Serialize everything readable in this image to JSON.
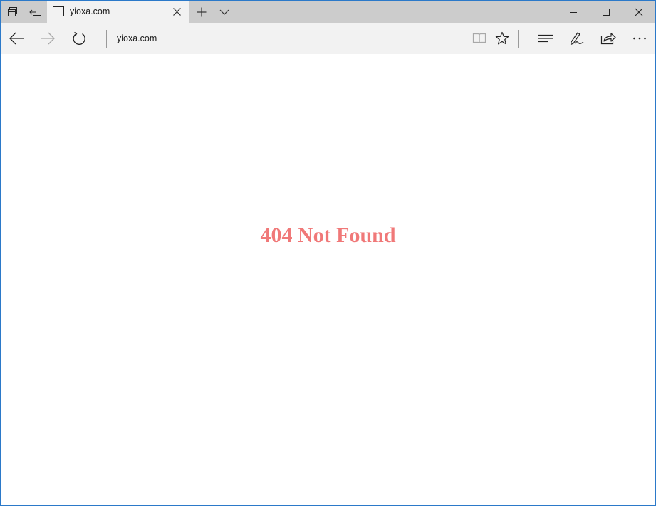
{
  "browser": {
    "tab": {
      "title": "yioxa.com",
      "icon": "page-icon"
    },
    "address": {
      "value": "yioxa.com"
    },
    "icons": {
      "tab_manager": "tab-manager-icon",
      "set_aside_tabs": "set-aside-tabs-icon",
      "new_tab": "plus-icon",
      "tab_preview": "chevron-down-icon",
      "minimize": "minimize-icon",
      "maximize": "maximize-icon",
      "close": "close-icon",
      "back": "back-arrow-icon",
      "forward": "forward-arrow-icon",
      "refresh": "refresh-icon",
      "reading_view": "book-icon",
      "favorite": "star-icon",
      "hub": "hub-icon",
      "web_note": "pen-icon",
      "share": "share-icon",
      "more": "more-icon"
    },
    "colors": {
      "titlebar": "#cccccc",
      "toolbar": "#f2f2f2",
      "window_border": "#2b79c9"
    }
  },
  "page": {
    "heading": "404 Not Found",
    "heading_color": "#f07878"
  }
}
